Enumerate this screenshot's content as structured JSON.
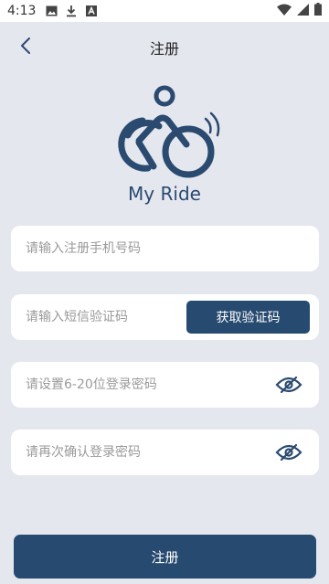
{
  "status_bar": {
    "time": "4:13",
    "left_icons": [
      "image-icon",
      "download-icon",
      "app-notification-icon"
    ],
    "right_icons": [
      "wifi-icon",
      "signal-icon",
      "battery-icon"
    ]
  },
  "header": {
    "title": "注册",
    "back_icon": "chevron-left-icon"
  },
  "logo": {
    "brand_name": "My Ride",
    "color": "#2a4a70"
  },
  "form": {
    "phone": {
      "placeholder": "请输入注册手机号码",
      "value": ""
    },
    "sms_code": {
      "placeholder": "请输入短信验证码",
      "value": "",
      "button_label": "获取验证码"
    },
    "password": {
      "placeholder": "请设置6-20位登录密码",
      "value": "",
      "toggle_icon": "eye-off-icon"
    },
    "confirm_password": {
      "placeholder": "请再次确认登录密码",
      "value": "",
      "toggle_icon": "eye-off-icon"
    }
  },
  "submit_label": "注册",
  "colors": {
    "background": "#e5e7ef",
    "primary": "#274a70",
    "field_bg": "#ffffff",
    "placeholder": "#9a9a9a"
  }
}
